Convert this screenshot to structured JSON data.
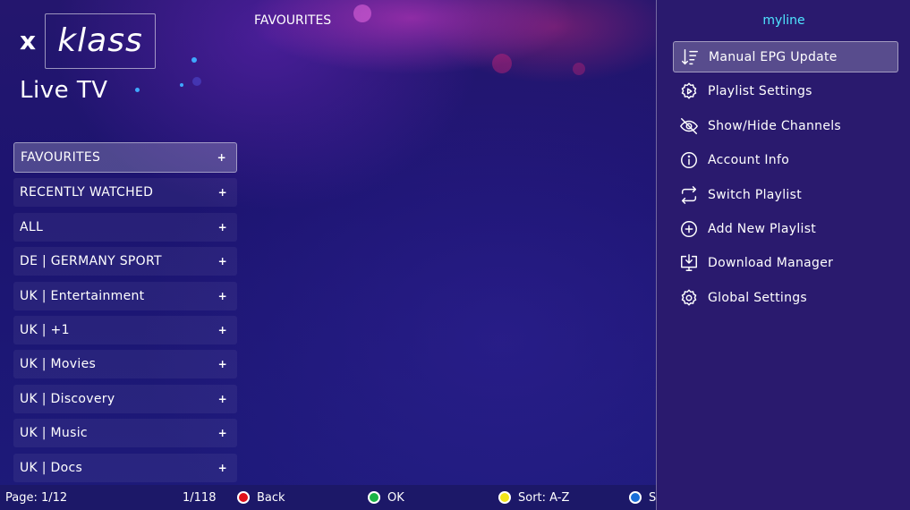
{
  "app": {
    "logo_x": "x",
    "logo_word": "klass",
    "page_title": "Live TV",
    "current_category": "FAVOURITES"
  },
  "categories": [
    {
      "label": "FAVOURITES",
      "selected": true
    },
    {
      "label": "RECENTLY WATCHED"
    },
    {
      "label": "ALL"
    },
    {
      "label": "DE | GERMANY SPORT"
    },
    {
      "label": "UK | Entertainment"
    },
    {
      "label": "UK | +1"
    },
    {
      "label": "UK | Movies"
    },
    {
      "label": "UK | Discovery"
    },
    {
      "label": "UK | Music"
    },
    {
      "label": "UK | Docs"
    }
  ],
  "category_expand_glyph": "+",
  "side_menu": {
    "username": "myline",
    "items": [
      {
        "label": "Manual EPG Update",
        "icon": "sort-down-icon",
        "selected": true
      },
      {
        "label": "Playlist Settings",
        "icon": "gear-play-icon"
      },
      {
        "label": "Show/Hide Channels",
        "icon": "eye-off-icon"
      },
      {
        "label": "Account Info",
        "icon": "info-icon"
      },
      {
        "label": "Switch Playlist",
        "icon": "switch-icon"
      },
      {
        "label": "Add New Playlist",
        "icon": "plus-circle-icon"
      },
      {
        "label": "Download Manager",
        "icon": "download-monitor-icon"
      },
      {
        "label": "Global Settings",
        "icon": "gear-icon"
      }
    ]
  },
  "bottom_bar": {
    "page": "Page: 1/12",
    "count": "1/118",
    "back": {
      "label": "Back",
      "color": "#e0101a"
    },
    "ok": {
      "label": "OK",
      "color": "#19b446"
    },
    "sort": {
      "label": "Sort: A-Z",
      "color": "#f2e51a"
    },
    "blue": {
      "label": "S",
      "color": "#1a6ed8"
    }
  },
  "colors": {
    "accent": "#4fe6ff",
    "panel": "#2a1a6e"
  }
}
